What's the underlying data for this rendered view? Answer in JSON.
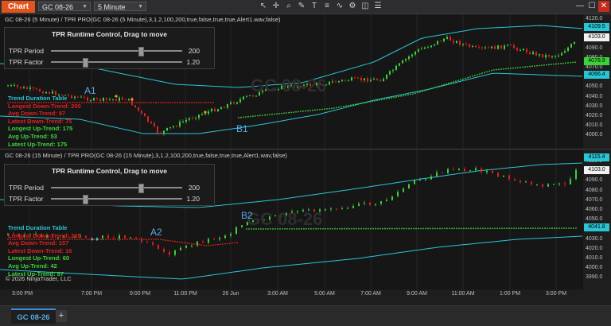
{
  "app": {
    "chart_button": "Chart"
  },
  "toolbar": {
    "instrument": "GC 08-26",
    "interval": "5 Minute",
    "icons": [
      "cursor-icon",
      "crosshair-icon",
      "zoom-icon",
      "draw-icon",
      "text-icon",
      "stack-icon",
      "indicator-icon",
      "strategy-icon",
      "snapshot-icon",
      "properties-icon"
    ]
  },
  "window": {
    "minimize": "—",
    "maximize": "☐",
    "close": "✕"
  },
  "panes": [
    {
      "title": "GC 08-26 (5 Minute) / TPR PRO(GC 08-26 (5 Minute),3,1.2,100,200,true,false,true,true,Alert1.wav,false)",
      "watermark": "GC 08-26",
      "control": {
        "title": "TPR Runtime Control, Drag to move",
        "period_label": "TPR Period",
        "period_value": "200",
        "factor_label": "TPR Factor",
        "factor_value": "1.20"
      },
      "table": {
        "title": "Trend Duration Table",
        "longest_down": "Longest Down-Trend: 200",
        "avg_down": "Avg Down-Trend: 97",
        "latest_down": "Latest Down-Trend: 75",
        "longest_up": "Longest Up-Trend: 175",
        "avg_up": "Avg Up-Trend: 53",
        "latest_up": "Latest Up-Trend: 175"
      },
      "labels": {
        "a": "A1",
        "b": "B1"
      },
      "yaxis": {
        "ticks": [
          "4120.0",
          "4110.0",
          "4100.0",
          "4090.0",
          "4080.0",
          "4070.0",
          "4060.0",
          "4050.0",
          "4040.0",
          "4030.0",
          "4020.0",
          "4010.0",
          "4000.0"
        ],
        "badges": {
          "upper": "4109.5",
          "price": "4103.0",
          "trail": "4078.9",
          "lower": "4066.4"
        }
      }
    },
    {
      "title": "GC 08-26 (15 Minute) / TPR PRO(GC 08-26 (15 Minute),3,1.2,100,200,true,false,true,true,Alert1.wav,false)",
      "watermark": "GC 08-26",
      "control": {
        "title": "TPR Runtime Control, Drag to move",
        "period_label": "TPR Period",
        "period_value": "200",
        "factor_label": "TPR Factor",
        "factor_value": "1.20"
      },
      "table": {
        "title": "Trend Duration Table",
        "longest_down": "Longest Down-Trend: 265",
        "avg_down": "Avg Down-Trend: 157",
        "latest_down": "Latest Down-Trend: 16",
        "longest_up": "Longest Up-Trend: 60",
        "avg_up": "Avg Up-Trend: 42",
        "latest_up": "Latest Up-Trend: 57"
      },
      "labels": {
        "a": "A2",
        "b": "B2"
      },
      "copyright": "© 2026 NinjaTrader, LLC",
      "yaxis": {
        "ticks": [
          "4110.0",
          "4100.0",
          "4090.0",
          "4080.0",
          "4070.0",
          "4060.0",
          "4050.0",
          "4040.0",
          "4030.0",
          "4020.0",
          "4010.0",
          "4000.0",
          "3990.0"
        ],
        "badges": {
          "upper": "4115.4",
          "price": "4103.0",
          "trail": "4041.8"
        }
      }
    }
  ],
  "xaxis": [
    "3:00 PM",
    "7:00 PM",
    "9:00 PM",
    "11:00 PM",
    "26 Jun",
    "3:00 AM",
    "5:00 AM",
    "7:00 AM",
    "9:00 AM",
    "11:00 AM",
    "1:00 PM",
    "3:00 PM"
  ],
  "tabs": {
    "active": "GC 08-26",
    "add": "+"
  },
  "colors": {
    "accent": "#e2541b",
    "up": "#3cd23c",
    "down": "#e02020",
    "band": "#29c5d6",
    "table_title": "#29c5d6",
    "label": "#5aa9e6",
    "badge_cyan": "#29c5d6",
    "badge_green": "#3cd23c"
  }
}
